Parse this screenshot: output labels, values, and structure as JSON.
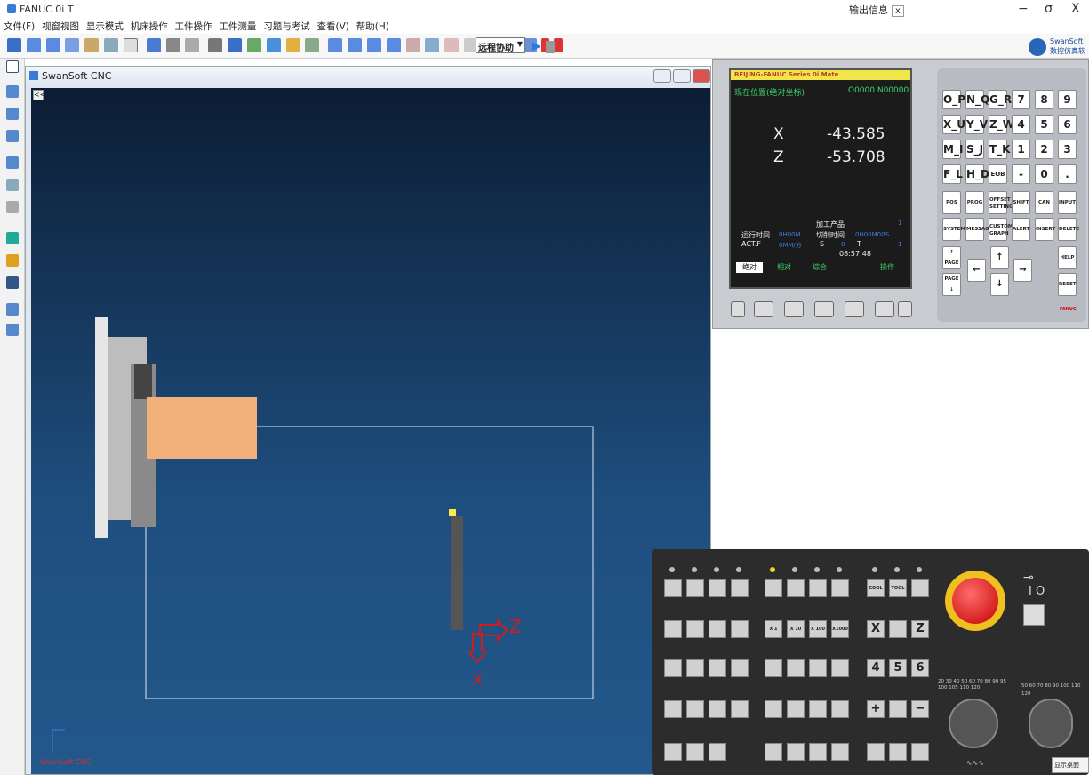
{
  "app": {
    "title": "FANUC 0i T",
    "output_label": "输出信息",
    "output_close": "x"
  },
  "window_controls": {
    "minimize": "−",
    "restore": "σ",
    "close": "X"
  },
  "menu": [
    "文件(F)",
    "视窗视图",
    "显示模式",
    "机床操作",
    "工件操作",
    "工件测量",
    "习题与考试",
    "查看(V)",
    "帮助(H)"
  ],
  "toolbar": {
    "remote_assist": "远程协助"
  },
  "brand": {
    "line1": "SwanSoft",
    "line2": "数控仿真软"
  },
  "sim_window": {
    "title": "SwanSoft CNC",
    "collapse": "<<",
    "axis_x": "X",
    "axis_z": "Z",
    "coord_caption": "SwanSoft CNC"
  },
  "cnc_screen": {
    "header": "BEIJING-FANUC Series 0i Mate",
    "pos_title": "现在位置(绝对坐标)",
    "prog": "O0000 N00000",
    "x_label": "X",
    "x_value": "-43.585",
    "z_label": "Z",
    "z_value": "-53.708",
    "parts_label": "加工产品",
    "parts_value": "1",
    "run_label": "运行时间",
    "run_value": "0H00M",
    "cut_label": "切削时间",
    "cut_value": "0H00M00S",
    "actf_label": "ACT.F",
    "actf_value": "0MM/分",
    "s_label": "S",
    "s_value": "0",
    "t_label": "T",
    "t_value": "1",
    "clock": "08:57:48",
    "soft_abs": "绝对",
    "soft_rel": "相对",
    "soft_all": "综合",
    "soft_op": "操作"
  },
  "keypad": {
    "row1": [
      "O_P",
      "N_Q",
      "G_R",
      "7",
      "8",
      "9"
    ],
    "row2": [
      "X_U",
      "Y_V",
      "Z_W",
      "4",
      "5",
      "6"
    ],
    "row3": [
      "M_I",
      "S_J",
      "T_K",
      "1",
      "2",
      "3"
    ],
    "row4": [
      "F_L",
      "H_D",
      "EOB",
      "-",
      "0",
      ". "
    ],
    "fn1": [
      "POS",
      "PROG",
      "OFFSET SETTING",
      "SHIFT",
      "CAN",
      "INPUT"
    ],
    "fn2": [
      "SYSTEM",
      "MESSAGE",
      "CUSTOM GRAPH",
      "ALERT",
      "INSERT",
      "DELETE"
    ],
    "page_up": "PAGE",
    "page_down": "PAGE",
    "help": "HELP",
    "reset": "RESET",
    "fanuc": "FANUC"
  },
  "op_panel": {
    "cool": "COOL",
    "tool": "TOOL",
    "x": "X",
    "z": "Z",
    "n4": "4",
    "n5": "5",
    "n6": "6",
    "plus": "+",
    "minus": "−",
    "x1": "X 1",
    "x10": "X 10",
    "x100": "X 100",
    "x1000": "X1000",
    "feed_ticks": "20 30 40 50 60 70 80 90 95 100 105 110 120",
    "spindle_ticks": "50 60 70 80 90 100 110 120",
    "show_desktop": "显示桌面"
  }
}
